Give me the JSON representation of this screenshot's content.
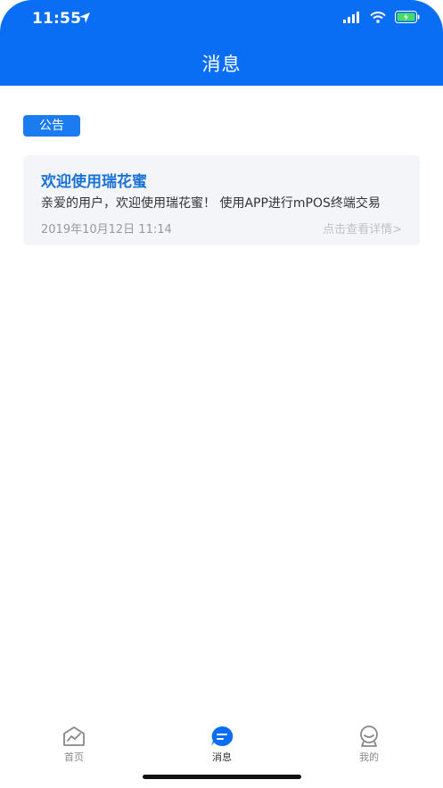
{
  "status_bar": {
    "time": "11:55"
  },
  "header": {
    "title": "消息"
  },
  "badge": {
    "label": "公告"
  },
  "notice": {
    "title": "欢迎使用瑞花蜜",
    "body": "亲爱的用户，欢迎使用瑞花蜜！ 使用APP进行mPOS终端交易",
    "date": "2019年10月12日 11:14",
    "detail_link": "点击查看详情>"
  },
  "tabbar": {
    "items": [
      {
        "label": "首页",
        "icon": "home-chart-icon"
      },
      {
        "label": "消息",
        "icon": "message-icon",
        "active": true
      },
      {
        "label": "我的",
        "icon": "profile-icon"
      }
    ]
  },
  "colors": {
    "primary": "#0a6ef4",
    "title_blue": "#1a72d6",
    "card_bg": "#f4f5f8"
  }
}
